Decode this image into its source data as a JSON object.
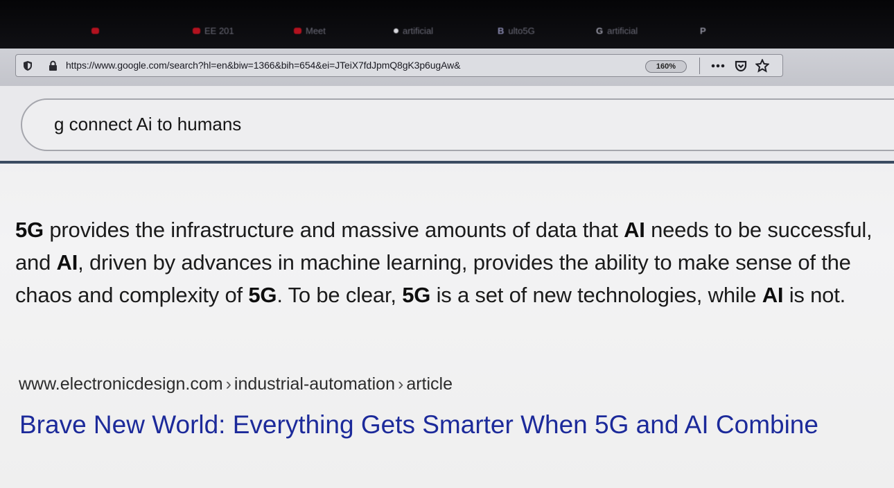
{
  "browser": {
    "tabs": [
      {
        "label": "",
        "favicon": "red-video-icon"
      },
      {
        "label": "EE 201",
        "favicon": "red-video-icon"
      },
      {
        "label": "Meet",
        "favicon": "red-video-icon"
      },
      {
        "label": "artificial",
        "favicon": "dot-icon"
      },
      {
        "label": "ulto5G",
        "favicon": "b-icon"
      },
      {
        "label": "artificial",
        "favicon": "g-icon"
      },
      {
        "label": "",
        "favicon": "p-icon"
      }
    ],
    "url": "https://www.google.com/search?hl=en&biw=1366&bih=654&ei=JTeiX7fdJpmQ8gK3p6ugAw&",
    "zoom": "160%"
  },
  "search": {
    "query": "g connect Ai to humans"
  },
  "snippet": {
    "parts": [
      {
        "text": "5G",
        "bold": true
      },
      {
        "text": " provides the infrastructure and massive amounts of data that ",
        "bold": false
      },
      {
        "text": "AI",
        "bold": true
      },
      {
        "text": " needs to be successful, and ",
        "bold": false
      },
      {
        "text": "AI",
        "bold": true
      },
      {
        "text": ", driven by advances in machine learning, provides the ability to make sense of the chaos and complexity of ",
        "bold": false
      },
      {
        "text": "5G",
        "bold": true
      },
      {
        "text": ". To be clear, ",
        "bold": false
      },
      {
        "text": "5G",
        "bold": true
      },
      {
        "text": " is a set of new technologies, while ",
        "bold": false
      },
      {
        "text": "AI",
        "bold": true
      },
      {
        "text": " is not.",
        "bold": false
      }
    ]
  },
  "result": {
    "breadcrumb": [
      "www.electronicdesign.com",
      "industrial-automation",
      "article"
    ],
    "breadcrumb_separator": "›",
    "title": "Brave New World: Everything Gets Smarter When 5G and AI Combine"
  },
  "colors": {
    "link_blue": "#1c2a9a",
    "tab_bar": "#0b0b0e",
    "divider": "#3b4c62"
  }
}
